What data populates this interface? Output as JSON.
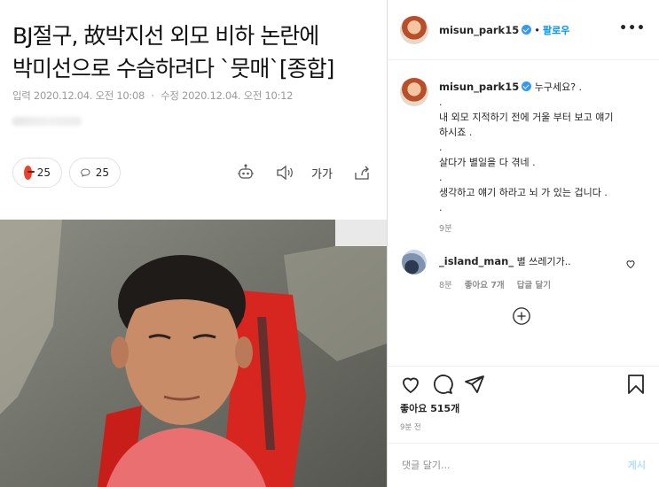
{
  "article": {
    "headline_line1": "BJ절구, 故박지선 외모 비하 논란에",
    "headline_line2": "박미선으로 수습하려다 `뭇매`[종합]",
    "input_label": "입력",
    "input_time": "2020.12.04. 오전 10:08",
    "edit_label": "수정",
    "edit_time": "2020.12.04. 오전 10:12",
    "reaction_count": "25",
    "comment_count": "25",
    "font_size_label": "가가"
  },
  "instagram": {
    "username": "misun_park15",
    "follow_label": "팔로우",
    "dot": "•",
    "more": "•••",
    "caption": {
      "username": "misun_park15",
      "lines": [
        "누구세요? .",
        ".",
        "내 외모 지적하기 전에 거울 부터 보고 얘기",
        "하시죠 .",
        ".",
        "살다가 별일을 다 겪네 .",
        ".",
        "생각하고 얘기 하라고 뇌 가 있는 겁니다 .",
        "."
      ],
      "time": "9분"
    },
    "reply": {
      "username": "_island_man_",
      "text": "별 쓰레기가..",
      "time": "8분",
      "likes": "좋아요 7개",
      "reply_btn": "답글 달기"
    },
    "likes": "좋아요 515개",
    "post_time": "9분 전",
    "comment_placeholder": "댓글 달기...",
    "post_button": "게시"
  },
  "icons": {
    "angry": "angry-face-icon",
    "comment": "comment-bubble-icon",
    "robot": "robot-icon",
    "speaker": "speaker-icon",
    "share": "share-icon",
    "heart": "heart-icon",
    "ig_comment": "comment-icon",
    "send": "send-icon",
    "bookmark": "bookmark-icon",
    "add": "plus-circle-icon"
  }
}
